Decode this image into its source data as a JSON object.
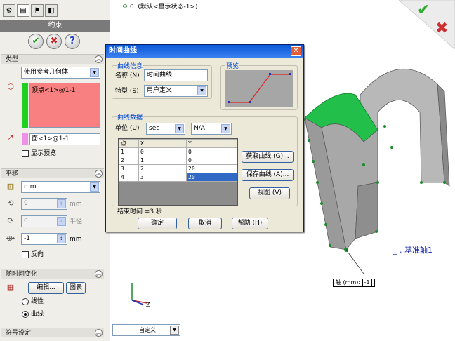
{
  "viewport": {
    "config_text": "(默认<显示状态-1>)",
    "config_count": "0",
    "axis_label": "基准轴1",
    "axis_callout": "轴 (mm):",
    "axis_value": "-1",
    "bottom_combo": "自定义",
    "model_color": "#9a9a9a",
    "highlight_color": "#22c04a"
  },
  "panel": {
    "title": "约束",
    "type_section": {
      "title": "类型",
      "mode": "使用参考几何体",
      "vertex_item": "顶点<1>@1-1",
      "face_item": "面<1>@1-1",
      "show_preview": "显示预览"
    },
    "translate_section": {
      "title": "平移",
      "unit": "mm",
      "field1": "0",
      "field1_unit": "mm",
      "field2": "0",
      "field2_label": "半径",
      "field3": "-1",
      "field3_unit": "mm",
      "reverse": "反向"
    },
    "time_section": {
      "title": "随时间变化",
      "edit_button": "编辑...",
      "chart_button": "图表",
      "opt_linear": "线性",
      "opt_curve": "曲线"
    },
    "symbol_section": {
      "title": "符号设定"
    }
  },
  "dialog": {
    "title": "时间曲线",
    "info_group": "曲线信息",
    "name_label": "名称 (N)",
    "name_value": "时间曲线",
    "type_label": "特型 (S)",
    "type_value": "用户定义",
    "preview_group": "预览",
    "data_group": "曲线数据",
    "unit_label": "单位 (U)",
    "unit_x": "sec",
    "unit_y": "N/A",
    "table": {
      "headers": [
        "点",
        "X",
        "Y"
      ],
      "rows": [
        [
          "1",
          "0",
          "0"
        ],
        [
          "2",
          "1",
          "0"
        ],
        [
          "3",
          "2",
          "20"
        ],
        [
          "4",
          "3",
          "20"
        ]
      ]
    },
    "get_curve": "获取曲线 (G)...",
    "save_curve": "保存曲线 (A)...",
    "view": "视图 (V)",
    "end_time": "结束时间 =3 秒",
    "ok": "确定",
    "cancel": "取消",
    "help": "帮助 (H)"
  }
}
